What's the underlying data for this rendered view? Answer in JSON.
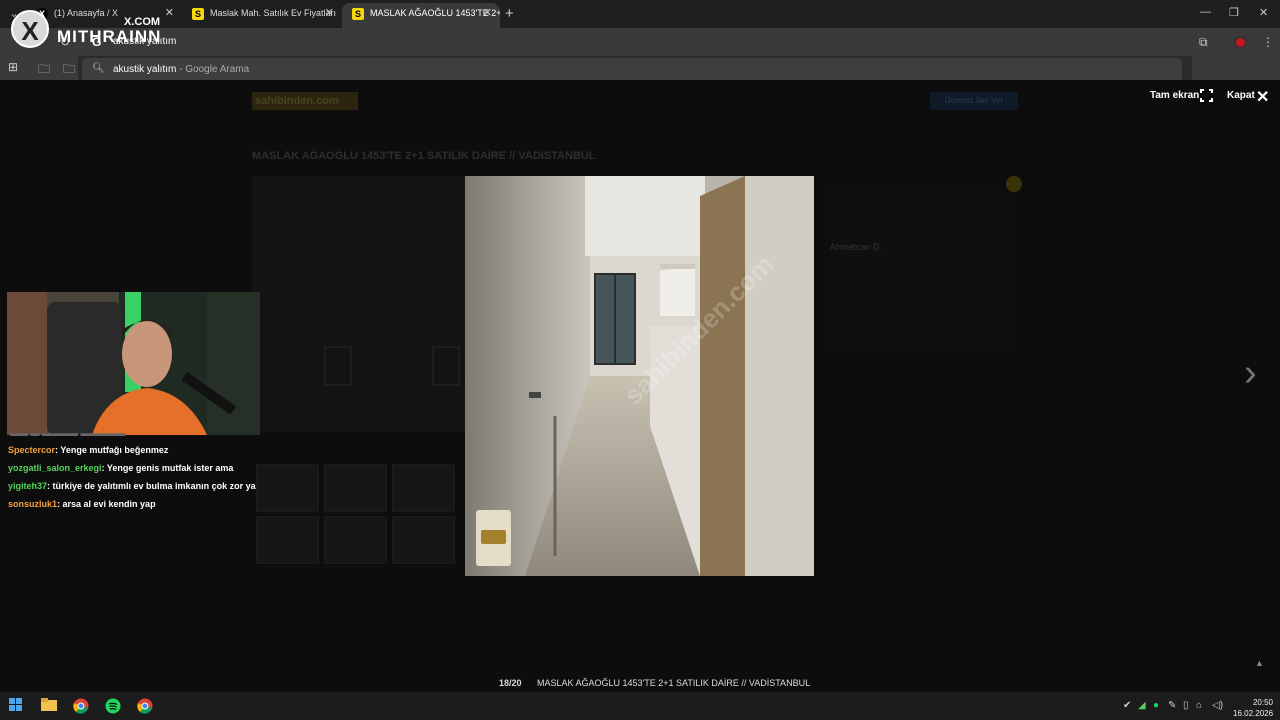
{
  "browser": {
    "tabs": [
      {
        "title": "(1) Anasayfa / X",
        "favicon": "X"
      },
      {
        "title": "Maslak Mah. Satılık Ev Fiyatları",
        "favicon": "S"
      },
      {
        "title": "MASLAK AĞAOĞLU 1453'TE 2+",
        "favicon": "S"
      }
    ],
    "omnibox_value": "akustik yalıtım",
    "suggestion": {
      "query": "akustik yalıtım",
      "source": " - Google Arama"
    }
  },
  "overlay": {
    "brand": "MITHRAINN",
    "brand_sub": "X.COM"
  },
  "lightbox": {
    "fullscreen_label": "Tam ekran",
    "close_label": "Kapat",
    "counter": "18/20",
    "caption": "MASLAK AĞAOĞLU 1453'TE 2+1 SATILIK DAİRE // VADİSTANBUL",
    "background_title": "MASLAK AĞAOĞLU 1453'TE 2+1 SATILIK DAİRE // VADİSTANBUL",
    "background_logo": "sahibinden.com",
    "background_button": "Ücretsiz İlan Ver",
    "agent_name": "Ahmetcan D.",
    "watermark": "sahibinden.com"
  },
  "chat": [
    {
      "user": "Spectercor",
      "color": "#f2a03d",
      "message": ": Yenge mutfağı beğenmez"
    },
    {
      "user": "yozgatli_salon_erkegi",
      "color": "#54d45a",
      "message": ": Yenge genis mutfak ister ama"
    },
    {
      "user": "yigiteh37",
      "color": "#54d45a",
      "message": ": türkiye de yalıtımlı ev bulma imkanın çok zor ya"
    },
    {
      "user": "sonsuzluk1",
      "color": "#f2a03d",
      "message": ": arsa al evi kendin yap"
    }
  ],
  "taskbar": {
    "time": "20:50",
    "date": "16.02.2026"
  },
  "colors": {
    "accent_yellow": "#f5d90a",
    "chrome_dark": "#1f1f1f",
    "toolbar": "#3a3a3a"
  }
}
